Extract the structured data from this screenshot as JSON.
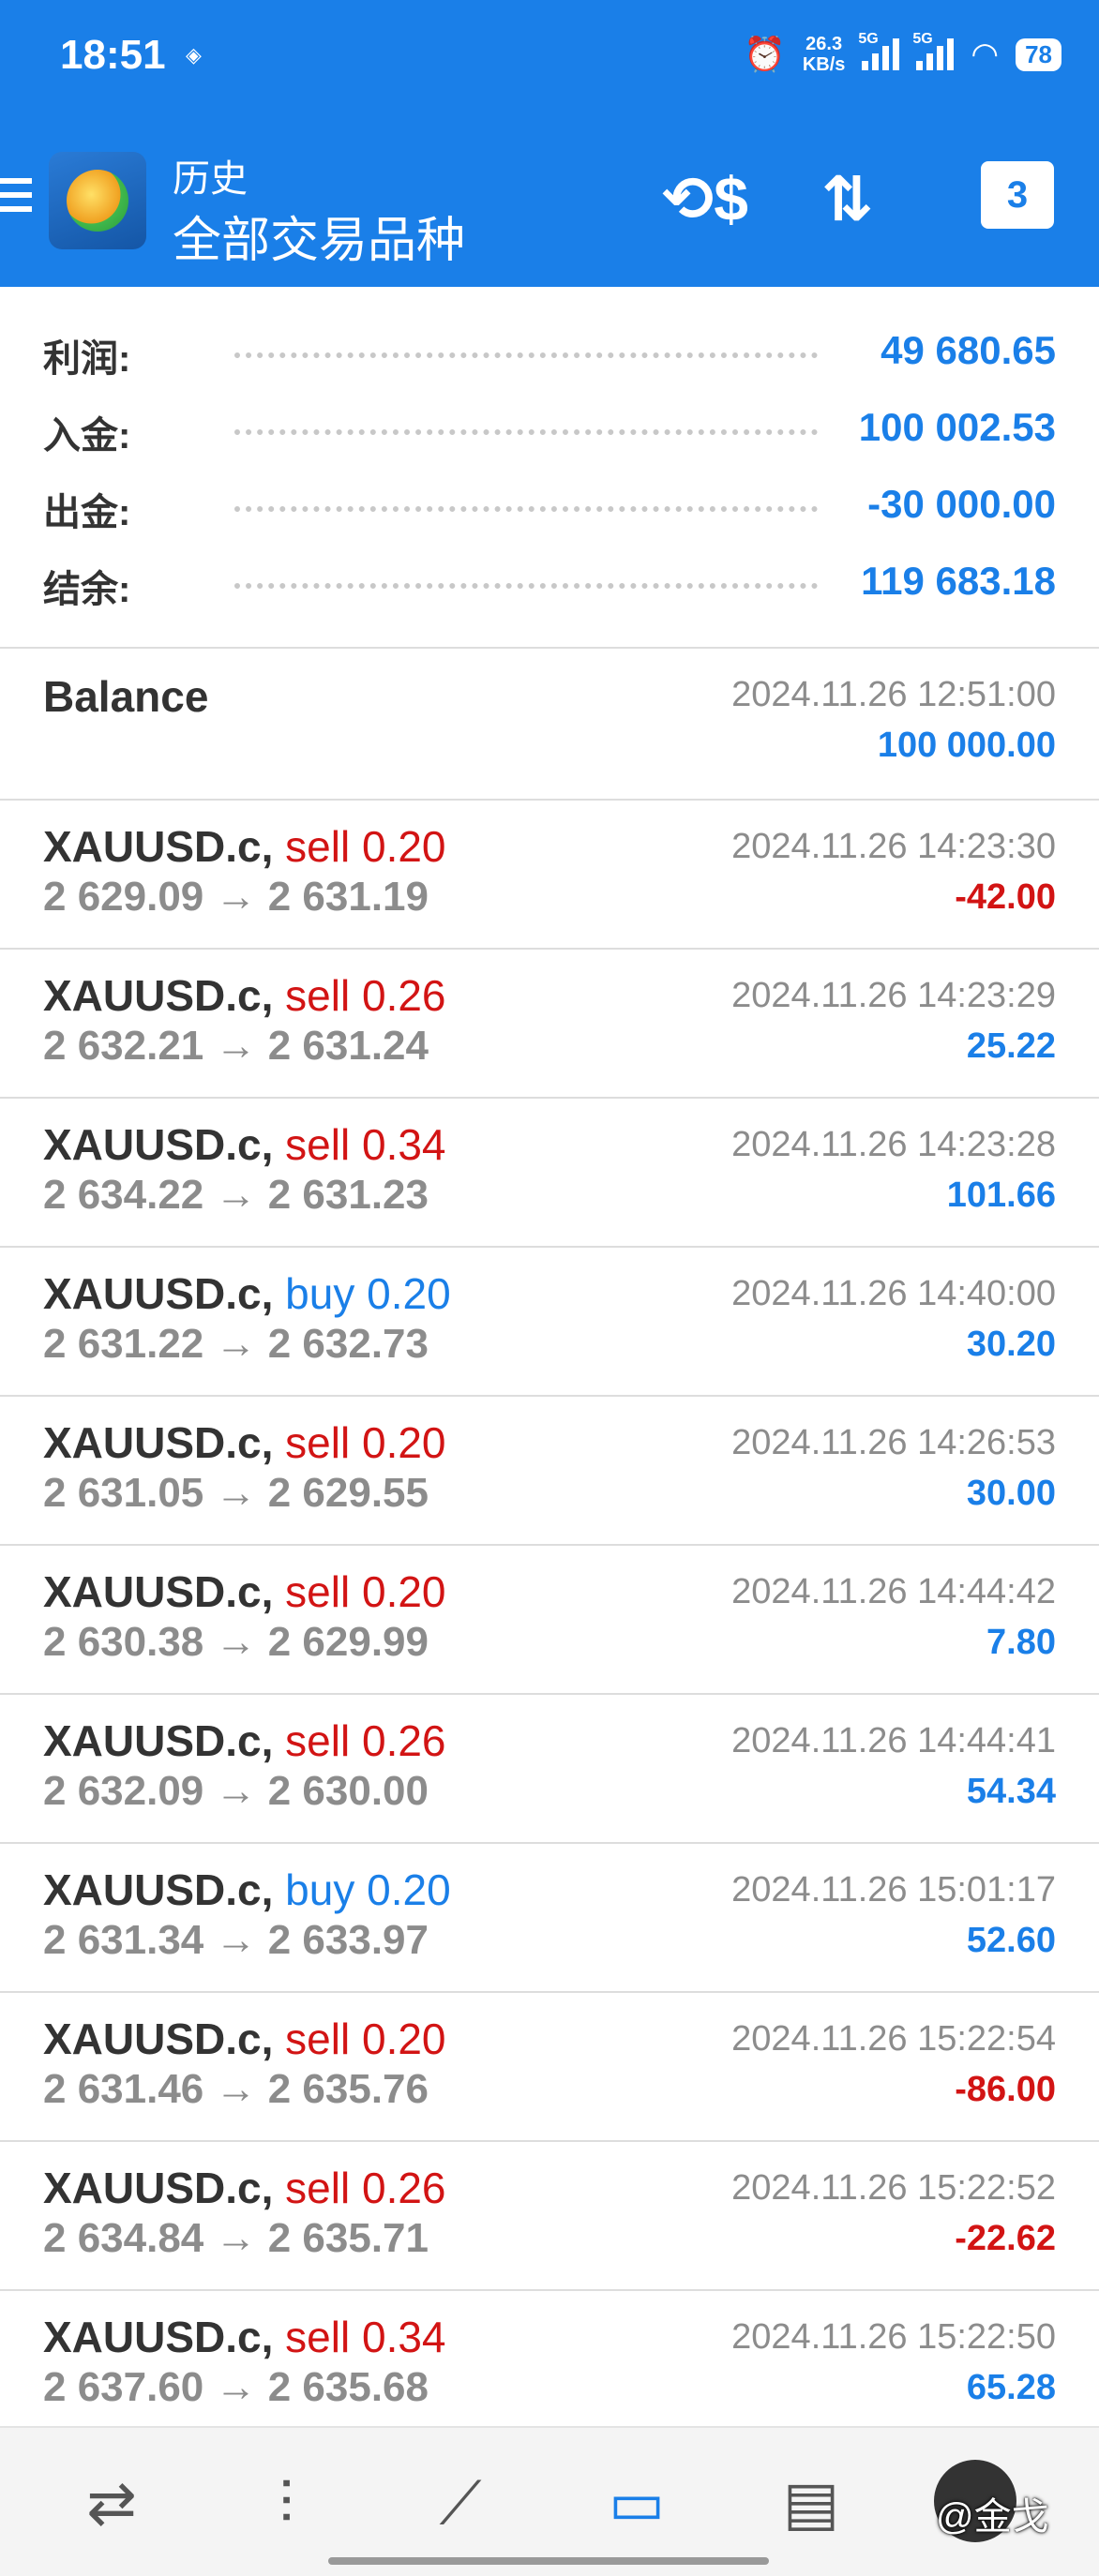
{
  "status_bar": {
    "time": "18:51",
    "net_speed_value": "26.3",
    "net_speed_unit": "KB/s",
    "signal_tag": "5G",
    "battery": "78"
  },
  "header": {
    "subtitle": "历史",
    "title": "全部交易品种",
    "calendar_day": "3"
  },
  "summary": [
    {
      "label": "利润:",
      "value": "49 680.65"
    },
    {
      "label": "入金:",
      "value": "100 002.53"
    },
    {
      "label": "出金:",
      "value": "-30 000.00"
    },
    {
      "label": "结余:",
      "value": "119 683.18"
    }
  ],
  "balance": {
    "label": "Balance",
    "time": "2024.11.26 12:51:00",
    "amount": "100 000.00"
  },
  "deals": [
    {
      "symbol": "XAUUSD.c,",
      "side": "sell",
      "volume": "0.20",
      "price": "2 629.09 → 2 631.19",
      "time": "2024.11.26 14:23:30",
      "profit": "-42.00"
    },
    {
      "symbol": "XAUUSD.c,",
      "side": "sell",
      "volume": "0.26",
      "price": "2 632.21 → 2 631.24",
      "time": "2024.11.26 14:23:29",
      "profit": "25.22"
    },
    {
      "symbol": "XAUUSD.c,",
      "side": "sell",
      "volume": "0.34",
      "price": "2 634.22 → 2 631.23",
      "time": "2024.11.26 14:23:28",
      "profit": "101.66"
    },
    {
      "symbol": "XAUUSD.c,",
      "side": "buy",
      "volume": "0.20",
      "price": "2 631.22 → 2 632.73",
      "time": "2024.11.26 14:40:00",
      "profit": "30.20"
    },
    {
      "symbol": "XAUUSD.c,",
      "side": "sell",
      "volume": "0.20",
      "price": "2 631.05 → 2 629.55",
      "time": "2024.11.26 14:26:53",
      "profit": "30.00"
    },
    {
      "symbol": "XAUUSD.c,",
      "side": "sell",
      "volume": "0.20",
      "price": "2 630.38 → 2 629.99",
      "time": "2024.11.26 14:44:42",
      "profit": "7.80"
    },
    {
      "symbol": "XAUUSD.c,",
      "side": "sell",
      "volume": "0.26",
      "price": "2 632.09 → 2 630.00",
      "time": "2024.11.26 14:44:41",
      "profit": "54.34"
    },
    {
      "symbol": "XAUUSD.c,",
      "side": "buy",
      "volume": "0.20",
      "price": "2 631.34 → 2 633.97",
      "time": "2024.11.26 15:01:17",
      "profit": "52.60"
    },
    {
      "symbol": "XAUUSD.c,",
      "side": "sell",
      "volume": "0.20",
      "price": "2 631.46 → 2 635.76",
      "time": "2024.11.26 15:22:54",
      "profit": "-86.00"
    },
    {
      "symbol": "XAUUSD.c,",
      "side": "sell",
      "volume": "0.26",
      "price": "2 634.84 → 2 635.71",
      "time": "2024.11.26 15:22:52",
      "profit": "-22.62"
    },
    {
      "symbol": "XAUUSD.c,",
      "side": "sell",
      "volume": "0.34",
      "price": "2 637.60 → 2 635.68",
      "time": "2024.11.26 15:22:50",
      "profit": "65.28"
    }
  ],
  "bottom_nav": [
    {
      "name": "quotes-icon",
      "glyph": "⇄"
    },
    {
      "name": "chart-icon",
      "glyph": "⫶"
    },
    {
      "name": "trade-icon",
      "glyph": "⟋"
    },
    {
      "name": "history-icon",
      "glyph": "▭"
    },
    {
      "name": "news-icon",
      "glyph": "▤"
    }
  ],
  "watermark": "@金戈",
  "colors": {
    "accent": "#1a7fe8",
    "loss": "#d21414",
    "muted": "#8c8c8c"
  }
}
